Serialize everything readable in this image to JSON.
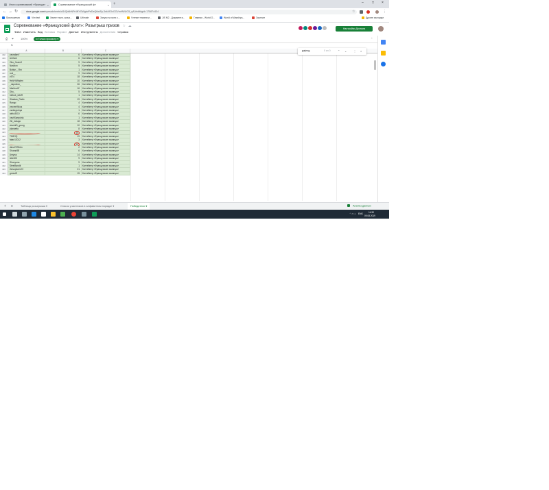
{
  "browser": {
    "tabs": [
      {
        "title": "Итоги соревнований «Француз»",
        "active": false
      },
      {
        "title": "Соревнование «Французский ф»",
        "active": true
      }
    ],
    "url_domain": "docs.google.com",
    "url_rest": "/spreadsheets/d/1tQb6hNPr4NYGWgtwPeDeQ6wiSy-3nkVfOvOOVmHWUO5_qAJ/edit#gid=175874434",
    "bookmarks": [
      {
        "label": "Приложения",
        "color": "#1a73e8"
      },
      {
        "label": "Vim test",
        "color": "#4285f4"
      },
      {
        "label": "Хватит ныть скача...",
        "color": "#0f9d58"
      },
      {
        "label": "Ultimate",
        "color": "#5f6368"
      },
      {
        "label": "Запуск на пути с...",
        "color": "#db4437"
      },
      {
        "label": "Чтение тематичи...",
        "color": "#f4b400"
      },
      {
        "label": "JIS M2 - Документа...",
        "color": "#5f6368"
      },
      {
        "label": "Главная - World O...",
        "color": "#f4b400"
      },
      {
        "label": "World of Warships...",
        "color": "#4285f4"
      },
      {
        "label": "Зарплат",
        "color": "#db4437"
      },
      {
        "label": "Другие закладки",
        "color": "#f4b400"
      }
    ]
  },
  "sheets": {
    "doc_title": "Соревнование «Французский флот»: Розыгрыш призов",
    "menu": [
      {
        "label": "Файл",
        "dim": false
      },
      {
        "label": "Изменить",
        "dim": false
      },
      {
        "label": "Вид",
        "dim": false
      },
      {
        "label": "Вставка",
        "dim": true
      },
      {
        "label": "Формат",
        "dim": true
      },
      {
        "label": "Данные",
        "dim": false
      },
      {
        "label": "Инструменты",
        "dim": false
      },
      {
        "label": "Дополнения",
        "dim": true
      },
      {
        "label": "Справка",
        "dim": false
      }
    ],
    "share_label": "Настройки Доступа",
    "zoom": "100%",
    "view_only_chip": "Только просмотр",
    "formula_placeholder": "fx",
    "column_headers": [
      "A",
      "B",
      "C"
    ],
    "find": {
      "query": "gajnog",
      "count": "0 из 0"
    },
    "rows": [
      {
        "n": "402",
        "a": "zavrafanV",
        "b": "6",
        "c": "Контейнер «Французские эсминцы»"
      },
      {
        "n": "403",
        "a": "Unihorn",
        "b": "6",
        "c": "Контейнер «Французские эсминцы»"
      },
      {
        "n": "404",
        "a": "Oko_Czarnif",
        "b": "9",
        "c": "Контейнер «Французские эсминцы»"
      },
      {
        "n": "405",
        "a": "Nashlon",
        "b": "5",
        "c": "Контейнер «Французские эсминцы»"
      },
      {
        "n": "406",
        "a": "Bottun__Rm",
        "b": "1",
        "c": "Контейнер «Французские эсминцы»"
      },
      {
        "n": "407",
        "a": "rocl__",
        "b": "9",
        "c": "Контейнер «Французские эсминцы»"
      },
      {
        "n": "408",
        "a": "z574",
        "b": "18",
        "c": "Контейнер «Французские эсминцы»"
      },
      {
        "n": "409",
        "a": "HellzYiWaden",
        "b": "10",
        "c": "Контейнер «Французские эсминцы»"
      },
      {
        "n": "410",
        "a": "_napoleon_",
        "b": "26",
        "c": "Контейнер «Французские эсминцы»"
      },
      {
        "n": "411",
        "a": "Marthodt7",
        "b": "16",
        "c": "Контейнер «Французские эсминцы»"
      },
      {
        "n": "412",
        "a": "Dko_",
        "b": "5",
        "c": "Контейнер «Французские эсминцы»"
      },
      {
        "n": "413",
        "a": "helbob_sSeR",
        "b": "1",
        "c": "Контейнер «Французские эсминцы»"
      },
      {
        "n": "414",
        "a": "Shastan_Rodix",
        "b": "19",
        "c": "Контейнер «Французские эсминцы»"
      },
      {
        "n": "415",
        "a": "Rango",
        "b": "4",
        "c": "Контейнер «Французские эсминцы»"
      },
      {
        "n": "416",
        "a": "zeovenWkus",
        "b": "4",
        "c": "Контейнер «Французские эсминцы»"
      },
      {
        "n": "417",
        "a": "zsekegrohya",
        "b": "1",
        "c": "Контейнер «Французские эсминцы»"
      },
      {
        "n": "418",
        "a": "alekc3010",
        "b": "6",
        "c": "Контейнер «Французские эсминцы»"
      },
      {
        "n": "419",
        "a": "vashSampdria",
        "b": "1",
        "c": "Контейнер «Французские эсминцы»"
      },
      {
        "n": "420",
        "a": "Zkl_vialugo",
        "b": "18",
        "c": "Контейнер «Французские эсминцы»"
      },
      {
        "n": "421",
        "a": "sborkkD_georg",
        "b": "10",
        "c": "Контейнер «Французские эсминцы»"
      },
      {
        "n": "422",
        "a": "planaetto",
        "b": "8",
        "c": "Контейнер «Французские эсминцы»",
        "scribble": false
      },
      {
        "n": "423",
        "a": "",
        "b": "10",
        "c": "Контейнер «Французские эсминцы»",
        "scribble": true,
        "circled": true
      },
      {
        "n": "424",
        "a": "TMZHQ",
        "b": "19",
        "c": "Контейнер «Французские эсминцы»"
      },
      {
        "n": "425",
        "a": "fatan12012",
        "b": "3",
        "c": "Контейнер «Французские эсминцы»"
      },
      {
        "n": "426",
        "a": "",
        "b": "10",
        "c": "Контейнер «Французские эсминцы»",
        "scribble": true,
        "circled": true
      },
      {
        "n": "427",
        "a": "dima7878rtm",
        "b": "2",
        "c": "Контейнер «Французские эсминцы»"
      },
      {
        "n": "428",
        "a": "Shuran8B",
        "b": "6",
        "c": "Контейнер «Французские эсминцы»"
      },
      {
        "n": "429",
        "a": "Amyrus",
        "b": "14",
        "c": "Контейнер «Французские эсминцы»"
      },
      {
        "n": "430",
        "a": "leile300",
        "b": "9",
        "c": "Контейнер «Французские эсминцы»"
      },
      {
        "n": "431",
        "a": "Shonyuna",
        "b": "9",
        "c": "Контейнер «Французские эсминцы»"
      },
      {
        "n": "432",
        "a": "SteelBandit",
        "b": "1",
        "c": "Контейнер «Французские эсминцы»"
      },
      {
        "n": "433",
        "a": "thesoptores72",
        "b": "21",
        "c": "Контейнер «Французские эсминцы»"
      },
      {
        "n": "434",
        "a": "greeutS",
        "b": "15",
        "c": "Контейнер «Французские эсминцы»"
      }
    ],
    "sheet_tabs": [
      {
        "label": "Таблица розыгрыша",
        "active": false
      },
      {
        "label": "Список участников в алфавитном порядке",
        "active": false
      },
      {
        "label": "Победители",
        "active": true
      }
    ],
    "explore_label": "Анализ данных"
  },
  "taskbar": {
    "lang": "ENG",
    "time": "14:30",
    "date": "09.08.2019"
  }
}
